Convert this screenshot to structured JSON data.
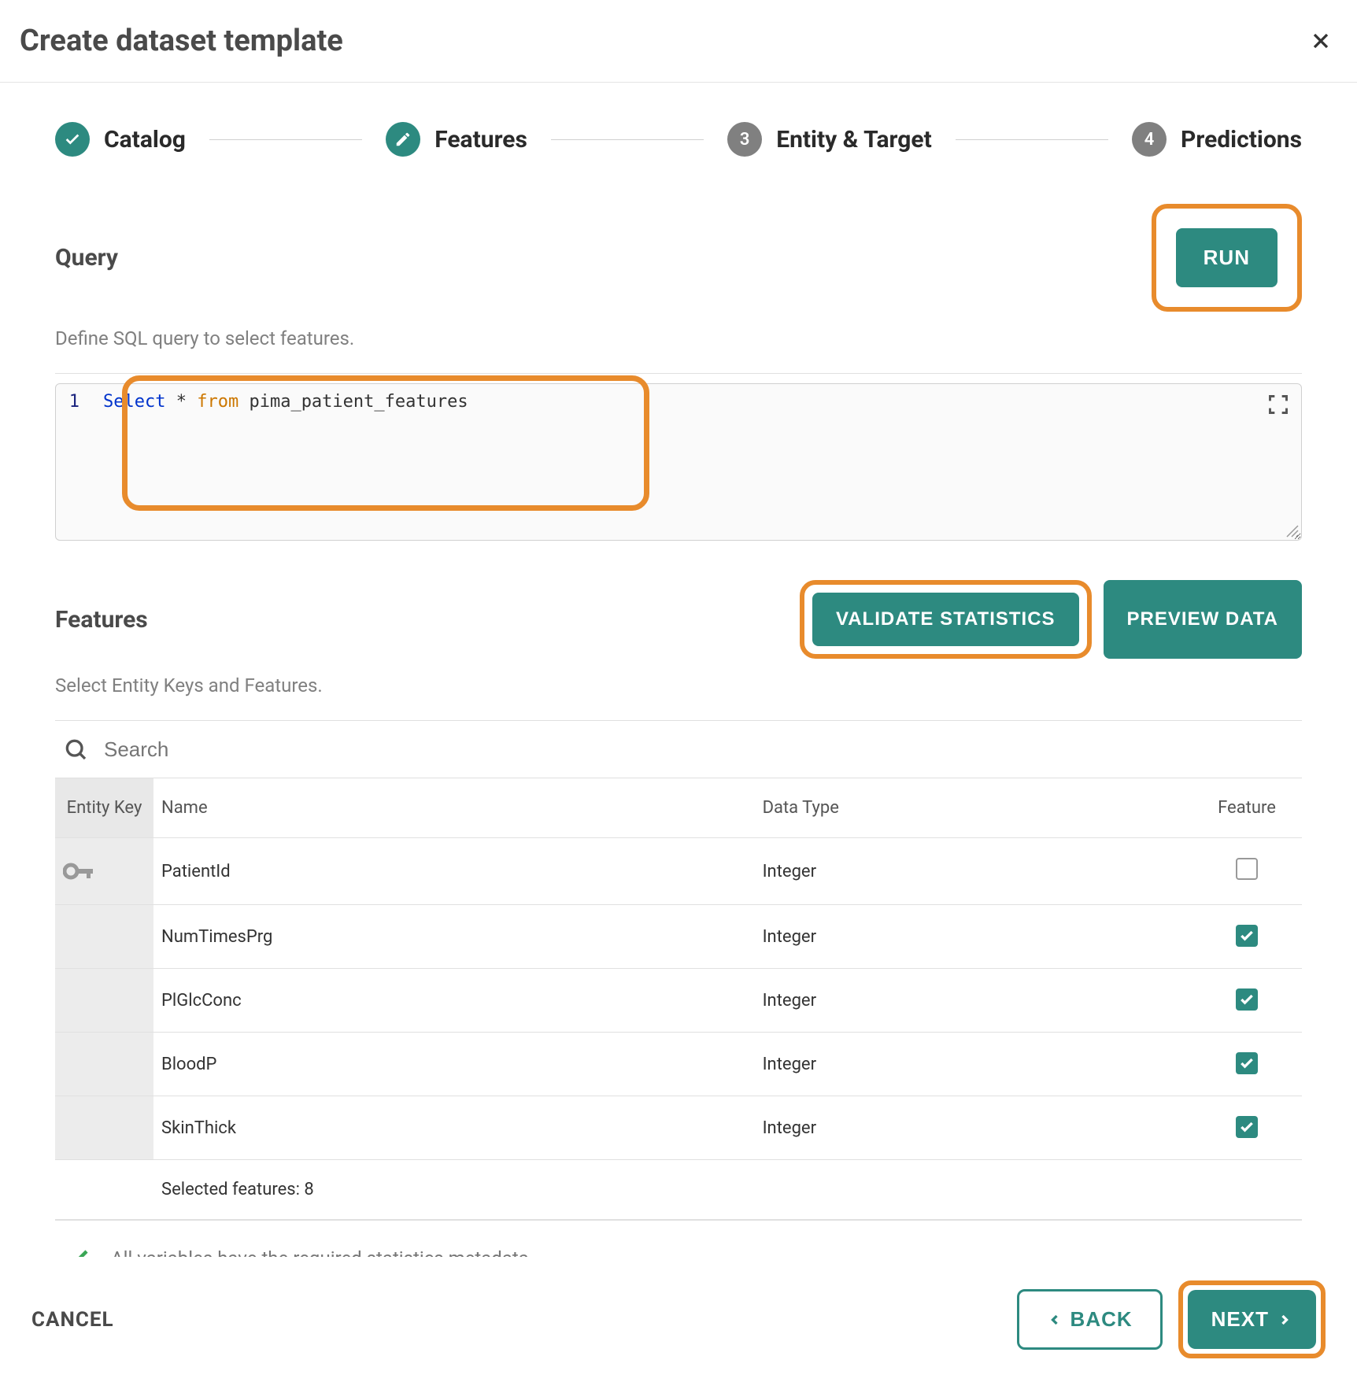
{
  "header": {
    "title": "Create dataset template"
  },
  "stepper": {
    "steps": [
      {
        "label": "Catalog",
        "state": "done",
        "indicator": "check"
      },
      {
        "label": "Features",
        "state": "active",
        "indicator": "edit"
      },
      {
        "label": "Entity & Target",
        "state": "inactive",
        "indicator": "3"
      },
      {
        "label": "Predictions",
        "state": "inactive",
        "indicator": "4"
      }
    ]
  },
  "query": {
    "title": "Query",
    "desc": "Define SQL query to select features.",
    "run_label": "RUN",
    "line_no": "1",
    "code_select": "Select",
    "code_star": " * ",
    "code_from": "from",
    "code_rest": " pima_patient_features"
  },
  "features": {
    "title": "Features",
    "desc": "Select Entity Keys and Features.",
    "validate_label": "VALIDATE STATISTICS",
    "preview_label": "PREVIEW DATA",
    "search_placeholder": "Search",
    "columns": {
      "entity_key": "Entity Key",
      "name": "Name",
      "data_type": "Data Type",
      "feature": "Feature"
    },
    "rows": [
      {
        "entity_key": true,
        "name": "PatientId",
        "data_type": "Integer",
        "checked": false
      },
      {
        "entity_key": false,
        "name": "NumTimesPrg",
        "data_type": "Integer",
        "checked": true
      },
      {
        "entity_key": false,
        "name": "PlGlcConc",
        "data_type": "Integer",
        "checked": true
      },
      {
        "entity_key": false,
        "name": "BloodP",
        "data_type": "Integer",
        "checked": true
      },
      {
        "entity_key": false,
        "name": "SkinThick",
        "data_type": "Integer",
        "checked": true
      }
    ],
    "selected_label": "Selected features: 8",
    "validation_msg": "All variables have the required statistics metadata."
  },
  "footer": {
    "cancel": "CANCEL",
    "back": "BACK",
    "next": "NEXT"
  }
}
